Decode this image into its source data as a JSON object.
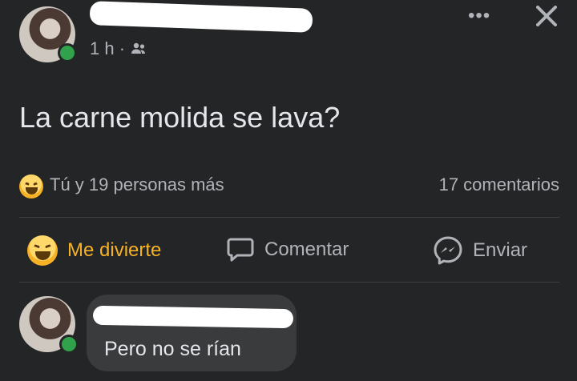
{
  "post": {
    "time": "1 h ·",
    "text": "La carne molida se lava?"
  },
  "reactions": {
    "summary": "Tú y 19 personas más",
    "comments": "17 comentarios"
  },
  "actions": {
    "react_label": "Me divierte",
    "comment_label": "Comentar",
    "send_label": "Enviar"
  },
  "comment": {
    "text": "Pero no se rían"
  },
  "colors": {
    "accent_haha": "#f7b125",
    "online": "#31a24c"
  }
}
